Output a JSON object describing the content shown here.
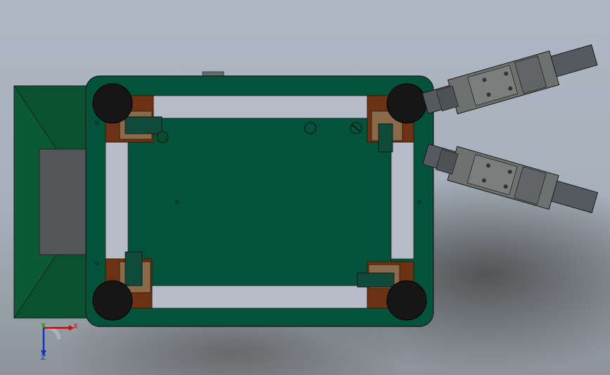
{
  "viewport": {
    "background_top": "#aeb8c4",
    "background_bottom": "#8c939a"
  },
  "model": {
    "board_color": "#02533a",
    "front_panel_color": "#0c5a35",
    "frame_color": "#b8bcc8",
    "wheel_color": "#161616",
    "mount_color": "#6b3214",
    "screen_color": "#55565a",
    "clamp_color": "#6f7070"
  },
  "triad": {
    "x_label": "X",
    "y_label": "Y",
    "z_label": "Z",
    "x_color": "#d40000",
    "y_color": "#10a010",
    "z_color": "#1030c0"
  }
}
